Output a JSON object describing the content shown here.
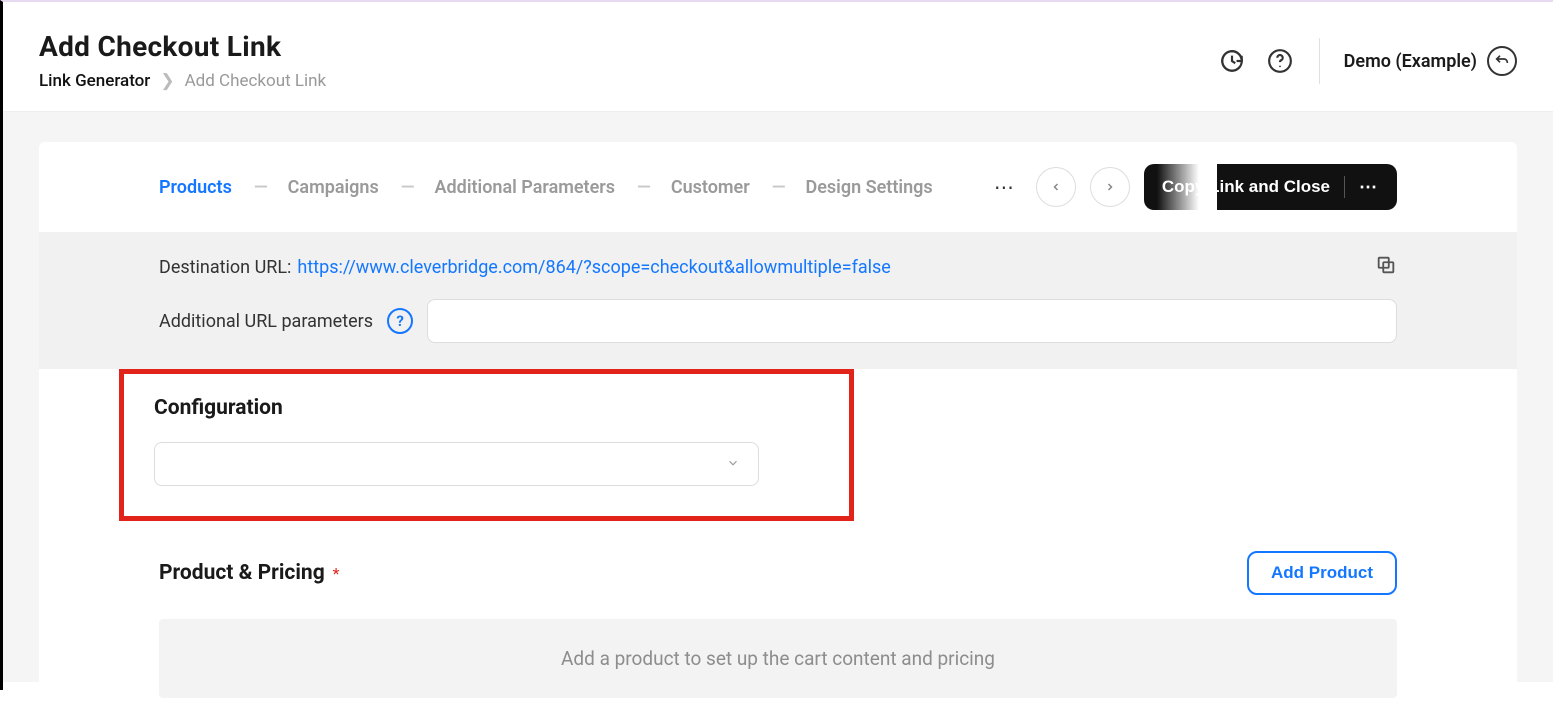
{
  "header": {
    "title": "Add Checkout Link",
    "breadcrumb_root": "Link Generator",
    "breadcrumb_current": "Add Checkout Link",
    "account_label": "Demo (Example)"
  },
  "tabs": {
    "items": [
      "Products",
      "Campaigns",
      "Additional Parameters",
      "Customer",
      "Design Settings"
    ],
    "copy_button": "Copy Link and Close"
  },
  "url": {
    "destination_label": "Destination URL:",
    "destination_value": "https://www.cleverbridge.com/864/?scope=checkout&allowmultiple=false",
    "params_label": "Additional URL parameters",
    "params_value": ""
  },
  "config": {
    "title": "Configuration",
    "selected": ""
  },
  "pricing": {
    "title": "Product & Pricing",
    "add_button": "Add Product",
    "empty_text": "Add a product to set up the cart content and pricing"
  }
}
